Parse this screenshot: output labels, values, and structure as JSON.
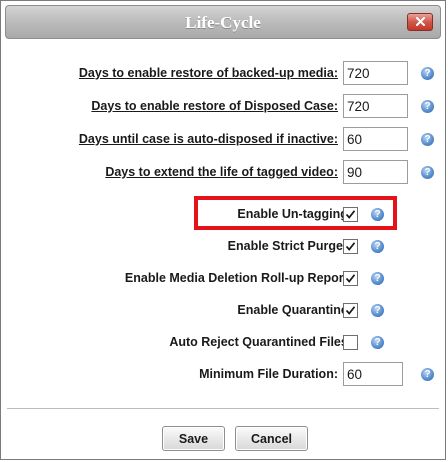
{
  "dialog": {
    "title": "Life-Cycle",
    "colors": {
      "highlight": "#e3121b",
      "help_icon": "#3a73c0"
    }
  },
  "fields": [
    {
      "label": "Days to enable restore of backed-up media:",
      "value": "720"
    },
    {
      "label": "Days to enable restore of Disposed Case:",
      "value": "720"
    },
    {
      "label": "Days until case is auto-disposed if inactive:",
      "value": "60"
    },
    {
      "label": "Days to extend the life of tagged video:",
      "value": "90"
    }
  ],
  "options": [
    {
      "label": "Enable Un-tagging:",
      "checked": true
    },
    {
      "label": "Enable Strict Purger:",
      "checked": true
    },
    {
      "label": "Enable Media Deletion Roll-up Report:",
      "checked": true
    },
    {
      "label": "Enable Quarantine:",
      "checked": true
    },
    {
      "label": "Auto Reject Quarantined Files:",
      "checked": false
    }
  ],
  "min_duration": {
    "label": "Minimum File Duration:",
    "value": "60"
  },
  "help_glyph": "?",
  "buttons": {
    "save": "Save",
    "cancel": "Cancel"
  }
}
